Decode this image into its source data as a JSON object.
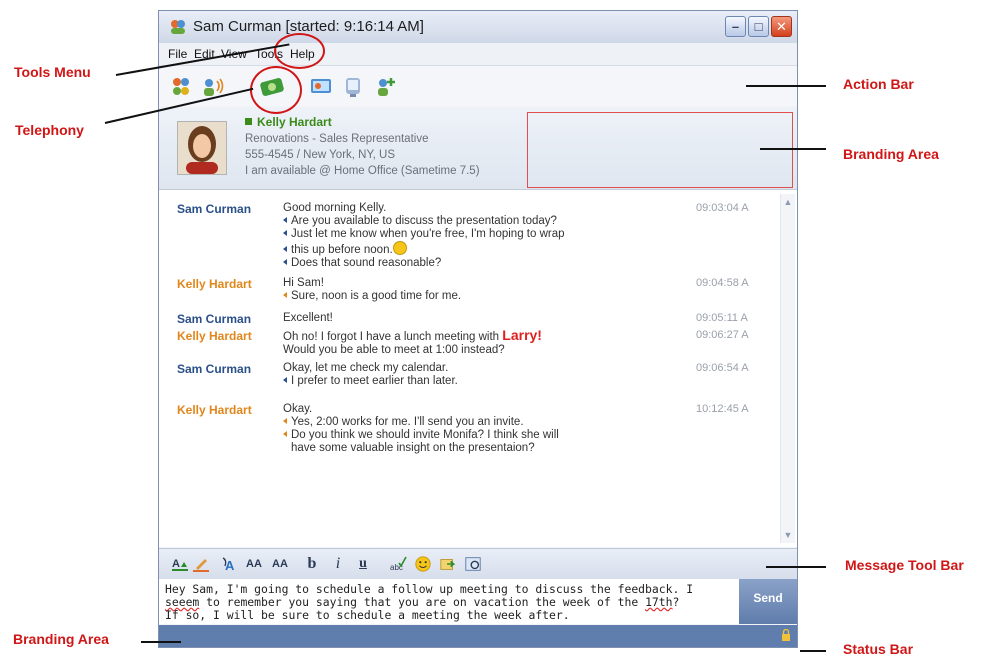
{
  "window": {
    "title": "Sam Curman [started: 9:16:14 AM]"
  },
  "menu": [
    "File",
    "Edit",
    "View",
    "Tools",
    "Help"
  ],
  "contact": {
    "name": "Kelly Hardart",
    "title": "Renovations - Sales Representative",
    "phone_location": "555-4545 / New York, NY, US",
    "status": "I am available @ Home Office (Sametime 7.5)"
  },
  "messages": [
    {
      "sender": "Sam Curman",
      "who": "sam",
      "time": "09:03:04 A",
      "lines": [
        "Good morning Kelly.",
        "Are you available to discuss the presentation today?",
        "Just let me know when you're free, I'm hoping to wrap",
        "this up before noon.",
        "Does that sound reasonable?"
      ]
    },
    {
      "sender": "Kelly Hardart",
      "who": "kelly",
      "time": "09:04:58 A",
      "lines": [
        "Hi Sam!",
        "Sure, noon is a good time for me."
      ]
    },
    {
      "sender": "Sam Curman",
      "who": "sam",
      "time": "09:05:11 A",
      "lines": [
        "Excellent!"
      ]
    },
    {
      "sender": "Kelly Hardart",
      "who": "kelly",
      "time": "09:06:27 A",
      "lines": [
        "Oh no! I forgot I have a lunch meeting with",
        "Would you be able to meet at 1:00 instead?"
      ],
      "highlight": "Larry!"
    },
    {
      "sender": "Sam Curman",
      "who": "sam",
      "time": "09:06:54 A",
      "lines": [
        "Okay, let me check my calendar.",
        "I prefer to meet earlier than later."
      ]
    },
    {
      "sender": "Kelly Hardart",
      "who": "kelly",
      "time": "10:12:45 A",
      "lines": [
        "Okay.",
        "Yes, 2:00 works for me. I'll send you an invite.",
        "Do you think we should invite Monifa? I think she will",
        "have some valuable insight on the presentaion?"
      ]
    }
  ],
  "compose": {
    "line1": "Hey Sam, I'm going to schedule a follow up meeting to discuss the feedback. I",
    "line2_a": "seeem",
    "line2_b": " to remember you saying that you are on vacation the week of the ",
    "line2_c": "17th",
    "line2_d": "?",
    "line3": "If so, I will be sure to schedule a meeting the week after."
  },
  "send_label": "Send",
  "toolbar_labels": {
    "font_larger": "AA",
    "font_smaller": "AA",
    "bold": "b",
    "italic": "i",
    "underline": "u"
  },
  "annotations": {
    "tools_menu": "Tools Menu",
    "telephony": "Telephony",
    "action_bar": "Action Bar",
    "branding_area_top": "Branding Area",
    "message_tool_bar": "Message Tool Bar",
    "branding_area_bottom": "Branding Area",
    "status_bar": "Status Bar"
  },
  "colors": {
    "annotation": "#d01616",
    "sam": "#2b4f8a",
    "kelly": "#e0861c",
    "status_bar": "#5f7eae"
  }
}
